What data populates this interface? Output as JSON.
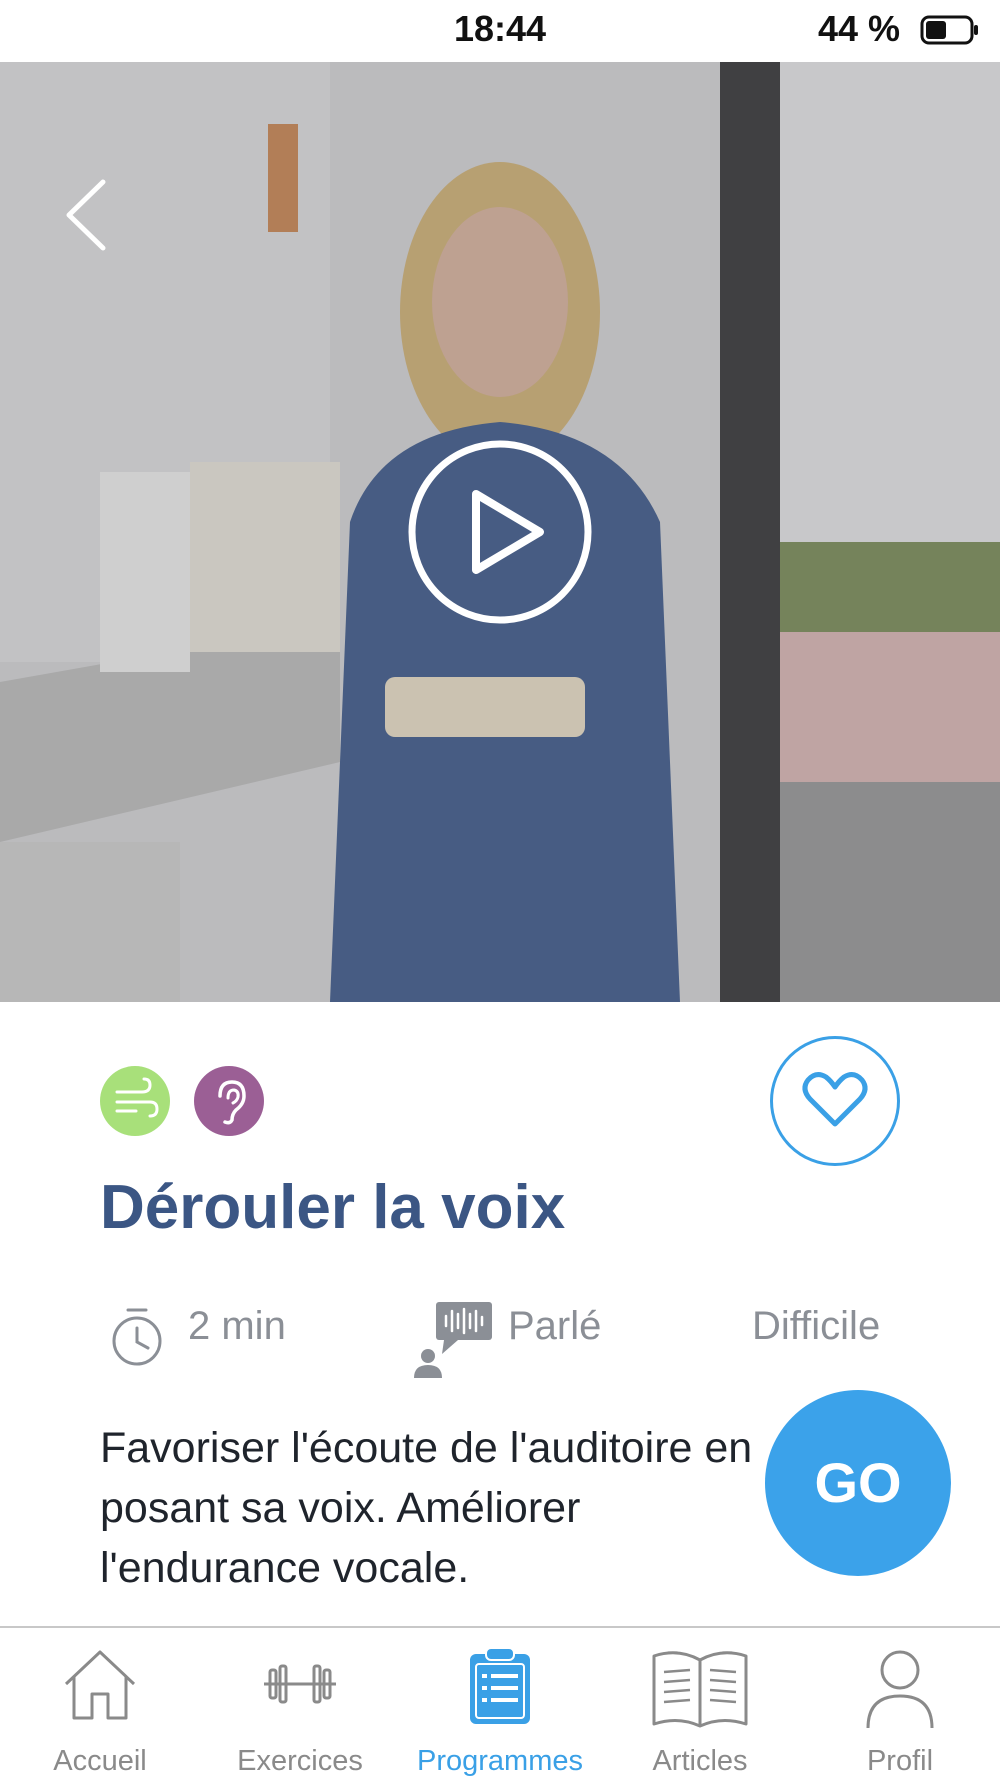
{
  "status_bar": {
    "time": "18:44",
    "battery": "44 %"
  },
  "exercise": {
    "title": "Dérouler la voix",
    "duration": "2 min",
    "mode": "Parlé",
    "difficulty": "Difficile",
    "description": "Favoriser l'écoute de l'auditoire en posant sa voix. Améliorer l'endurance vocale.",
    "go_label": "GO",
    "categories": [
      "breath-icon",
      "ear-icon"
    ]
  },
  "tabs": [
    {
      "label": "Accueil",
      "icon": "home-icon"
    },
    {
      "label": "Exercices",
      "icon": "dumbbell-icon"
    },
    {
      "label": "Programmes",
      "icon": "clipboard-icon",
      "active": true
    },
    {
      "label": "Articles",
      "icon": "book-icon"
    },
    {
      "label": "Profil",
      "icon": "person-icon"
    }
  ],
  "colors": {
    "accent": "#3aa0e6",
    "title": "#3b5684",
    "breath": "#a8e07a",
    "ear": "#9b5f95"
  }
}
